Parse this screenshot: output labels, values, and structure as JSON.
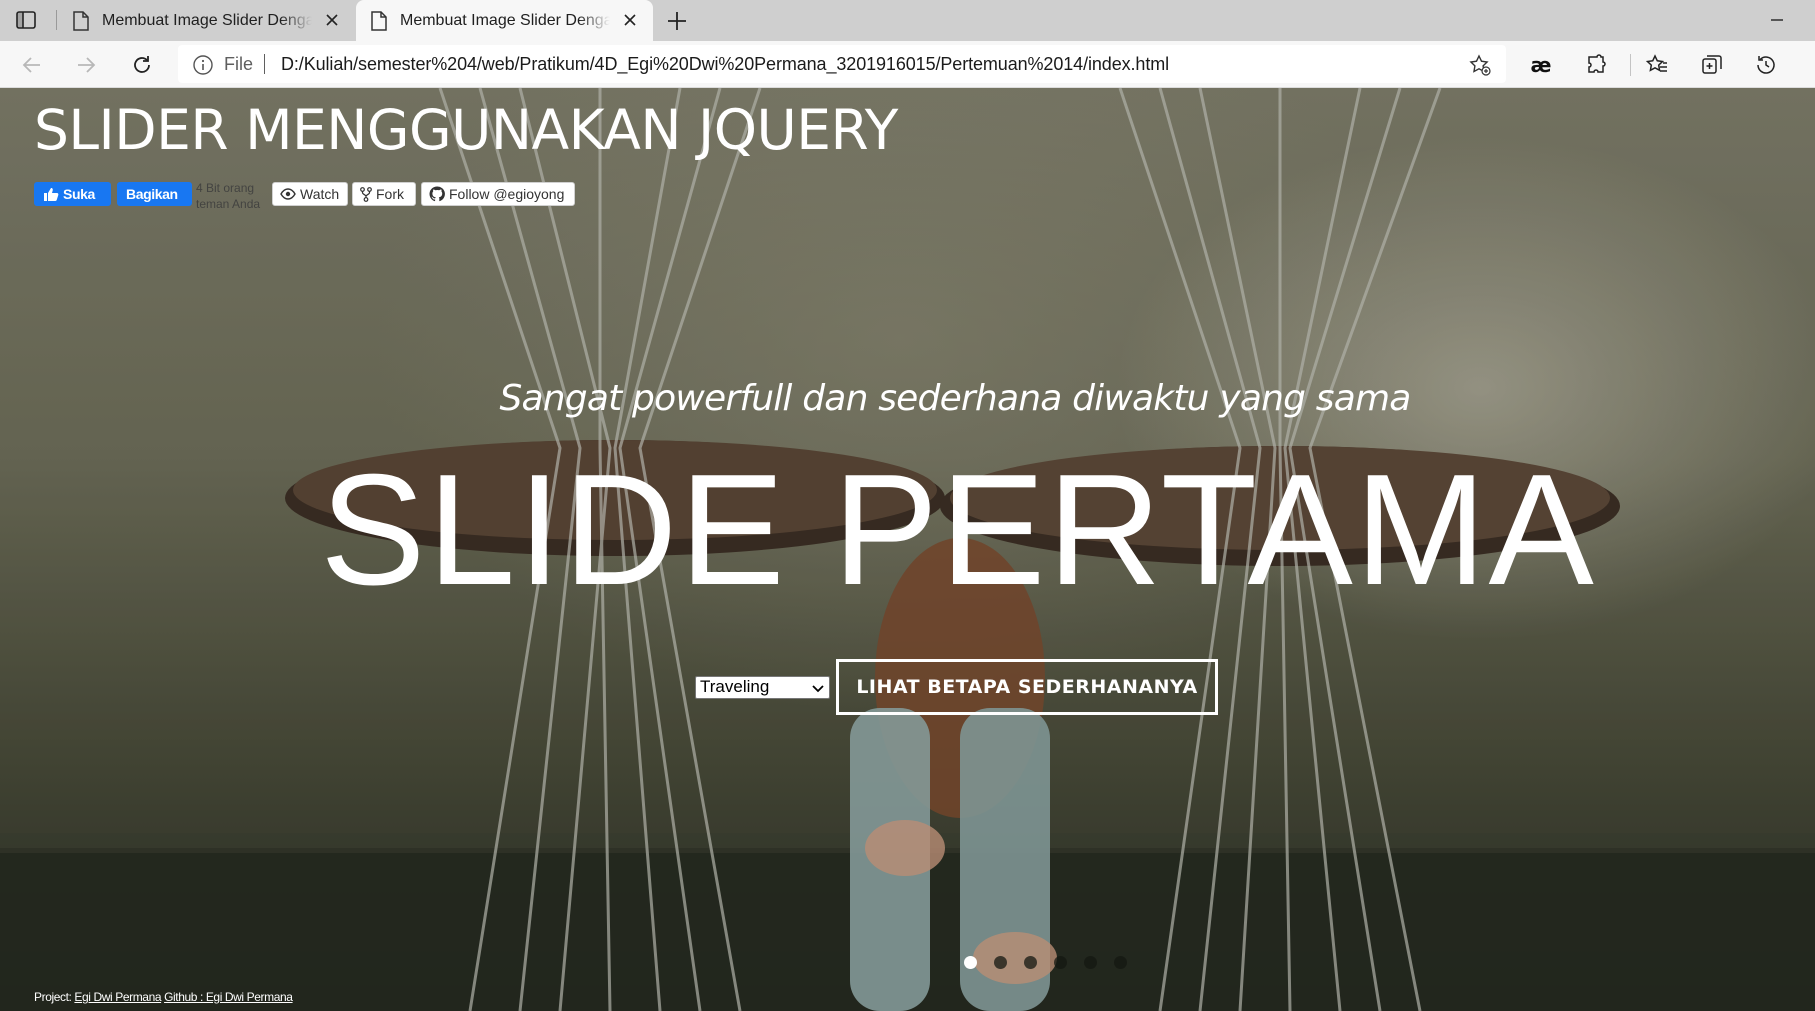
{
  "browser": {
    "tabs": [
      {
        "title": "Membuat Image Slider Dengan J",
        "active": false
      },
      {
        "title": "Membuat Image Slider Dengan J",
        "active": true
      }
    ],
    "address_bar": {
      "scheme_label": "File",
      "url": "D:/Kuliah/semester%204/web/Pratikum/4D_Egi%20Dwi%20Permana_3201916015/Pertemuan%2014/index.html"
    },
    "toolbar_icons": [
      "back-icon",
      "forward-icon",
      "refresh-icon",
      "info-icon",
      "add-favorite-icon",
      "ae-extension-icon",
      "extensions-icon",
      "favorites-icon",
      "collections-icon",
      "history-icon"
    ]
  },
  "page": {
    "site_title": "SLIDER MENGGUNAKAN JQUERY",
    "social": {
      "like_label": "Suka",
      "share_label": "Bagikan",
      "like_count_text": "4 Bit orang teman Anda",
      "watch_label": "Watch",
      "fork_label": "Fork",
      "follow_label": "Follow @egioyong"
    },
    "slide": {
      "tagline": "Sangat powerfull dan sederhana diwaktu yang sama",
      "title": "SLIDE PERTAMA",
      "select_value": "Traveling",
      "cta_label": "LIHAT BETAPA SEDERHANANYA"
    },
    "slider_dots": {
      "count": 6,
      "active_index": 0
    },
    "footer": {
      "project_label": "Project:",
      "project_link": "Egi Dwi Permana",
      "github_link": "Github : Egi Dwi Permana"
    }
  },
  "colors": {
    "facebook_blue": "#1877f2",
    "tab_strip": "#cfcfcf",
    "toolbar": "#f7f7f7",
    "text_white": "#ffffff"
  }
}
